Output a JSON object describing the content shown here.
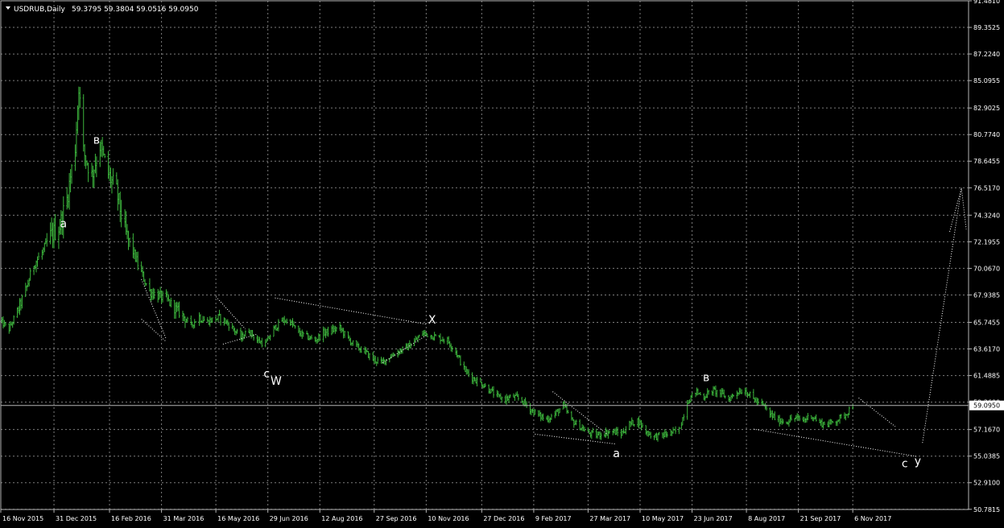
{
  "header": {
    "symbol": "USDRUB,Daily",
    "ohlc": "59.3795 59.3804 59.0516 59.0950",
    "menu_icon": "triangle-down-icon"
  },
  "colors": {
    "background": "#000000",
    "grid": "#7c7c7c",
    "bar": "#3cb43c",
    "text": "#ffffff",
    "price_line": "#b4b4b4"
  },
  "chart_data": {
    "type": "bar",
    "title": "USDRUB,Daily",
    "symbol": "USDRUB",
    "timeframe": "Daily",
    "ylim": [
      50.767,
      91.481
    ],
    "y_ticks": [
      "91.4810",
      "89.3525",
      "87.2240",
      "85.0955",
      "82.9025",
      "80.7740",
      "78.6455",
      "76.5170",
      "74.3240",
      "72.1955",
      "70.0670",
      "67.9385",
      "65.7455",
      "63.6170",
      "61.4885",
      "59.3600",
      "57.1670",
      "55.0385",
      "52.9100",
      "50.7815"
    ],
    "current_price": "59.0950",
    "x_ticks": [
      "16 Nov 2015",
      "31 Dec 2015",
      "16 Feb 2016",
      "31 Mar 2016",
      "16 May 2016",
      "29 Jun 2016",
      "12 Aug 2016",
      "27 Sep 2016",
      "10 Nov 2016",
      "27 Dec 2016",
      "9 Feb 2017",
      "27 Mar 2017",
      "10 May 2017",
      "23 Jun 2017",
      "8 Aug 2017",
      "21 Sep 2017",
      "6 Nov 2017"
    ],
    "x_range": [
      "2015-11-16",
      "2018-02-12"
    ],
    "grid": true,
    "series": [
      {
        "points": [
          [
            "2015-11-16",
            65.8
          ],
          [
            "2015-11-23",
            65.2
          ],
          [
            "2015-11-30",
            66.6
          ],
          [
            "2015-12-07",
            68.3
          ],
          [
            "2015-12-14",
            70.4
          ],
          [
            "2015-12-21",
            71.3
          ],
          [
            "2015-12-28",
            72.6
          ],
          [
            "2016-01-05",
            73.5
          ],
          [
            "2016-01-11",
            75.6
          ],
          [
            "2016-01-18",
            79.8
          ],
          [
            "2016-01-21",
            84.7
          ],
          [
            "2016-01-25",
            79.4
          ],
          [
            "2016-02-01",
            77.5
          ],
          [
            "2016-02-08",
            79.9
          ],
          [
            "2016-02-15",
            77.6
          ],
          [
            "2016-02-22",
            76.2
          ],
          [
            "2016-02-29",
            73.0
          ],
          [
            "2016-03-07",
            71.4
          ],
          [
            "2016-03-14",
            69.7
          ],
          [
            "2016-03-21",
            68.2
          ],
          [
            "2016-03-28",
            67.9
          ],
          [
            "2016-04-04",
            67.6
          ],
          [
            "2016-04-11",
            66.9
          ],
          [
            "2016-04-18",
            66.3
          ],
          [
            "2016-04-25",
            65.5
          ],
          [
            "2016-05-02",
            66.2
          ],
          [
            "2016-05-09",
            65.8
          ],
          [
            "2016-05-16",
            66.1
          ],
          [
            "2016-05-23",
            65.9
          ],
          [
            "2016-05-30",
            65.3
          ],
          [
            "2016-06-06",
            64.5
          ],
          [
            "2016-06-13",
            65.1
          ],
          [
            "2016-06-20",
            64.3
          ],
          [
            "2016-06-27",
            64.0
          ],
          [
            "2016-07-04",
            65.2
          ],
          [
            "2016-07-11",
            65.9
          ],
          [
            "2016-07-18",
            65.8
          ],
          [
            "2016-07-25",
            64.9
          ],
          [
            "2016-08-01",
            64.6
          ],
          [
            "2016-08-08",
            64.3
          ],
          [
            "2016-08-15",
            64.9
          ],
          [
            "2016-08-22",
            65.1
          ],
          [
            "2016-08-29",
            65.3
          ],
          [
            "2016-09-05",
            64.4
          ],
          [
            "2016-09-12",
            63.8
          ],
          [
            "2016-09-19",
            63.4
          ],
          [
            "2016-09-26",
            62.8
          ],
          [
            "2016-10-03",
            62.5
          ],
          [
            "2016-10-10",
            63.0
          ],
          [
            "2016-10-17",
            63.4
          ],
          [
            "2016-10-24",
            63.7
          ],
          [
            "2016-10-31",
            64.2
          ],
          [
            "2016-11-07",
            64.9
          ],
          [
            "2016-11-14",
            64.7
          ],
          [
            "2016-11-21",
            64.5
          ],
          [
            "2016-11-28",
            64.3
          ],
          [
            "2016-12-05",
            63.4
          ],
          [
            "2016-12-12",
            62.0
          ],
          [
            "2016-12-19",
            61.3
          ],
          [
            "2016-12-26",
            60.9
          ],
          [
            "2017-01-02",
            60.4
          ],
          [
            "2017-01-09",
            59.8
          ],
          [
            "2017-01-16",
            59.6
          ],
          [
            "2017-01-23",
            59.8
          ],
          [
            "2017-01-30",
            59.5
          ],
          [
            "2017-02-06",
            58.8
          ],
          [
            "2017-02-13",
            58.3
          ],
          [
            "2017-02-20",
            58.0
          ],
          [
            "2017-02-27",
            58.4
          ],
          [
            "2017-03-06",
            59.1
          ],
          [
            "2017-03-13",
            57.9
          ],
          [
            "2017-03-20",
            57.4
          ],
          [
            "2017-03-27",
            56.9
          ],
          [
            "2017-04-03",
            56.7
          ],
          [
            "2017-04-10",
            56.9
          ],
          [
            "2017-04-17",
            57.0
          ],
          [
            "2017-04-24",
            56.8
          ],
          [
            "2017-05-01",
            57.6
          ],
          [
            "2017-05-08",
            57.9
          ],
          [
            "2017-05-15",
            57.0
          ],
          [
            "2017-05-22",
            56.6
          ],
          [
            "2017-05-29",
            56.7
          ],
          [
            "2017-06-05",
            56.9
          ],
          [
            "2017-06-12",
            57.1
          ],
          [
            "2017-06-19",
            59.4
          ],
          [
            "2017-06-26",
            60.2
          ],
          [
            "2017-07-03",
            59.8
          ],
          [
            "2017-07-10",
            60.3
          ],
          [
            "2017-07-17",
            60.1
          ],
          [
            "2017-07-24",
            59.6
          ],
          [
            "2017-07-31",
            60.2
          ],
          [
            "2017-08-07",
            60.3
          ],
          [
            "2017-08-14",
            59.6
          ],
          [
            "2017-08-21",
            59.2
          ],
          [
            "2017-08-28",
            58.4
          ],
          [
            "2017-09-04",
            57.9
          ],
          [
            "2017-09-11",
            57.8
          ],
          [
            "2017-09-18",
            58.1
          ],
          [
            "2017-09-25",
            57.9
          ],
          [
            "2017-10-02",
            58.3
          ],
          [
            "2017-10-09",
            57.7
          ],
          [
            "2017-10-16",
            57.6
          ],
          [
            "2017-10-23",
            57.9
          ],
          [
            "2017-10-30",
            58.3
          ],
          [
            "2017-11-06",
            59.1
          ]
        ]
      }
    ],
    "annotations": [
      {
        "text": "a",
        "date": "2016-01-08",
        "value": 73.6
      },
      {
        "text": "в",
        "date": "2016-02-05",
        "value": 80.3
      },
      {
        "text": "c",
        "date": "2016-06-28",
        "value": 61.6
      },
      {
        "text": "W",
        "date": "2016-07-06",
        "value": 61.0
      },
      {
        "text": "X",
        "date": "2016-11-15",
        "value": 65.9
      },
      {
        "text": "a",
        "date": "2017-04-20",
        "value": 55.2
      },
      {
        "text": "в",
        "date": "2017-07-05",
        "value": 61.3
      },
      {
        "text": "c",
        "date": "2017-12-20",
        "value": 54.4
      },
      {
        "text": "y",
        "date": "2017-12-31",
        "value": 54.6
      }
    ],
    "trend_lines": [
      {
        "from": [
          "2016-03-14",
          69.2
        ],
        "to": [
          "2016-04-04",
          64.4
        ]
      },
      {
        "from": [
          "2016-03-14",
          66.0
        ],
        "to": [
          "2016-04-04",
          64.2
        ]
      },
      {
        "from": [
          "2016-05-16",
          67.8
        ],
        "to": [
          "2016-06-10",
          65.2
        ]
      },
      {
        "from": [
          "2016-05-22",
          64.0
        ],
        "to": [
          "2016-06-20",
          64.8
        ]
      },
      {
        "from": [
          "2016-07-05",
          67.7
        ],
        "to": [
          "2016-11-10",
          65.6
        ]
      },
      {
        "from": [
          "2016-10-04",
          62.5
        ],
        "to": [
          "2016-11-10",
          64.7
        ]
      },
      {
        "from": [
          "2017-02-10",
          56.8
        ],
        "to": [
          "2017-04-20",
          56.0
        ]
      },
      {
        "from": [
          "2017-02-25",
          60.2
        ],
        "to": [
          "2017-04-12",
          56.8
        ]
      },
      {
        "from": [
          "2017-08-14",
          57.2
        ],
        "to": [
          "2017-12-31",
          55.0
        ]
      },
      {
        "from": [
          "2017-11-11",
          59.7
        ],
        "to": [
          "2017-12-12",
          57.4
        ]
      },
      {
        "from": [
          "2018-01-04",
          56.1
        ],
        "to": [
          "2018-02-06",
          76.5
        ]
      },
      {
        "from": [
          "2018-01-27",
          73.0
        ],
        "to": [
          "2018-02-06",
          76.5
        ]
      },
      {
        "from": [
          "2018-02-06",
          76.5
        ],
        "to": [
          "2018-02-10",
          73.2
        ]
      }
    ]
  }
}
